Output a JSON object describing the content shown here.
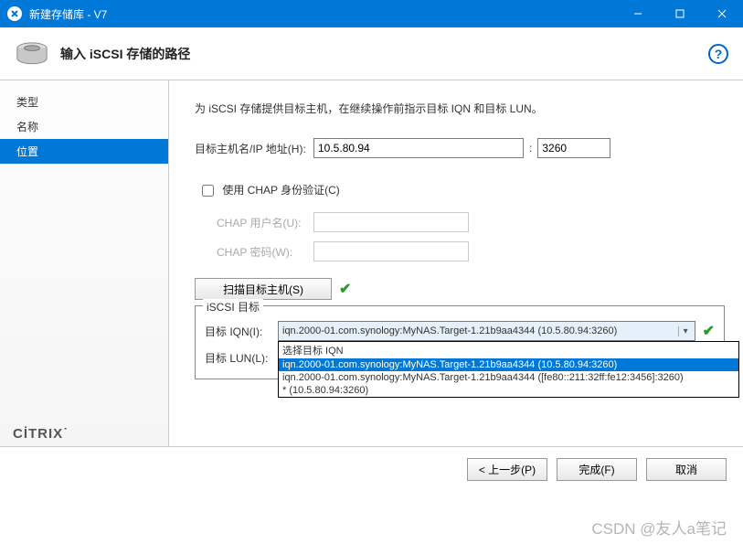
{
  "window": {
    "title": "新建存储库 - V7"
  },
  "header": {
    "title": "输入 iSCSI 存储的路径"
  },
  "sidebar": {
    "items": [
      {
        "label": "类型",
        "active": false
      },
      {
        "label": "名称",
        "active": false
      },
      {
        "label": "位置",
        "active": true
      }
    ]
  },
  "main": {
    "intro": "为 iSCSI 存储提供目标主机，在继续操作前指示目标 IQN 和目标 LUN。",
    "host_label": "目标主机名/IP 地址(H):",
    "host_value": "10.5.80.94",
    "port_value": "3260",
    "chap_checkbox_label": "使用 CHAP 身份验证(C)",
    "chap_user_label": "CHAP 用户名(U):",
    "chap_pass_label": "CHAP 密码(W):",
    "scan_button": "扫描目标主机(S)",
    "fieldset_legend": "iSCSI 目标",
    "iqn_label": "目标 IQN(I):",
    "lun_label": "目标 LUN(L):",
    "iqn_selected": "iqn.2000-01.com.synology:MyNAS.Target-1.21b9aa4344 (10.5.80.94:3260)",
    "iqn_options": [
      "选择目标 IQN",
      "iqn.2000-01.com.synology:MyNAS.Target-1.21b9aa4344 (10.5.80.94:3260)",
      "iqn.2000-01.com.synology:MyNAS.Target-1.21b9aa4344 ([fe80::211:32ff:fe12:3456]:3260)",
      "* (10.5.80.94:3260)"
    ]
  },
  "footer": {
    "back": "< 上一步(P)",
    "finish": "完成(F)",
    "cancel": "取消"
  },
  "brand": "CİTRIX",
  "watermark": "CSDN @友人a笔记"
}
